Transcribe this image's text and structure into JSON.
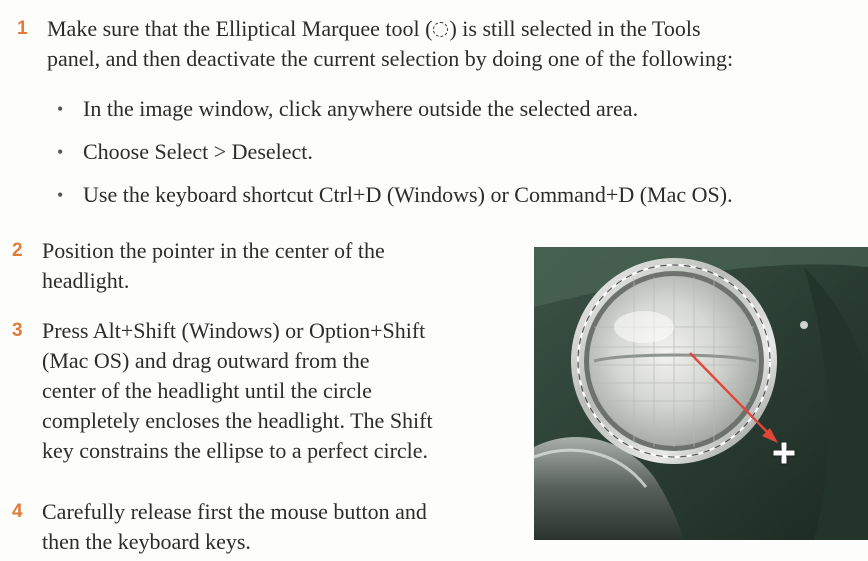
{
  "steps": [
    {
      "number": "1",
      "text_before_icon": "Make sure that the Elliptical Marquee tool (",
      "icon": "elliptical-marquee-icon",
      "text_after_icon_line1": ") is still selected in the Tools",
      "line2": "panel, and then deactivate the current selection by doing one of the following:",
      "bullets": [
        "In the image window, click anywhere outside the selected area.",
        "Choose Select > Deselect.",
        "Use the keyboard shortcut Ctrl+D (Windows) or Command+D (Mac OS)."
      ]
    },
    {
      "number": "2",
      "lines": [
        "Position the pointer in the center of the",
        "headlight."
      ]
    },
    {
      "number": "3",
      "lines": [
        "Press Alt+Shift (Windows) or Option+Shift",
        "(Mac OS) and drag outward from the",
        "center of the headlight until the circle",
        "completely encloses the headlight. The Shift",
        "key constrains the ellipse to a perfect circle."
      ]
    },
    {
      "number": "4",
      "lines": [
        "Carefully release first the mouse button and",
        "then the keyboard keys."
      ]
    }
  ],
  "colors": {
    "step_number": "#e07b3a",
    "text": "#2c2c2c",
    "arrow": "#e0463a"
  }
}
